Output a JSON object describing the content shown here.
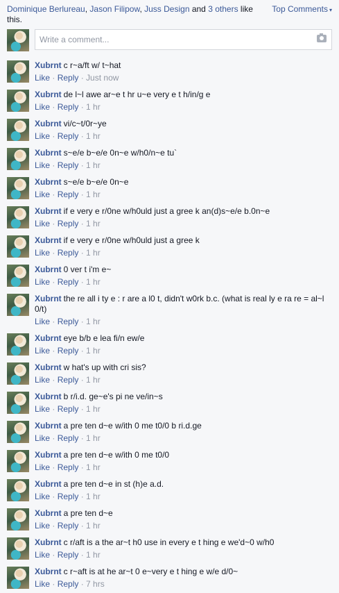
{
  "header": {
    "names_a": "Dominique Berlureau",
    "sep_a": ", ",
    "names_b": "Jason Filipow",
    "sep_b": ", ",
    "names_c": "Juss Design",
    "and": " and ",
    "others": "3 others",
    "like_this": " like this.",
    "sort_label": "Top Comments"
  },
  "composer": {
    "placeholder": "Write a comment..."
  },
  "labels": {
    "like": "Like",
    "reply": "Reply",
    "dot": " · "
  },
  "comments": [
    {
      "author": "Xubrnt",
      "text": "c r~a/ft w/ t~hat",
      "time": "Just now"
    },
    {
      "author": "Xubrnt",
      "text": "de l~l awe ar~e t hr u~e very e t h/in/g e",
      "time": "1 hr"
    },
    {
      "author": "Xubrnt",
      "text": "vi/c~t/0r~ye",
      "time": "1 hr"
    },
    {
      "author": "Xubrnt",
      "text": "s~e/e b~e/e 0n~e w/h0/n~e tu`",
      "time": "1 hr"
    },
    {
      "author": "Xubrnt",
      "text": "s~e/e b~e/e 0n~e",
      "time": "1 hr"
    },
    {
      "author": "Xubrnt",
      "text": "if e very e r/0ne w/h0uld just a gree k an(d)s~e/e b.0n~e",
      "time": "1 hr"
    },
    {
      "author": "Xubrnt",
      "text": "if e very e r/0ne w/h0uld just a gree k",
      "time": "1 hr"
    },
    {
      "author": "Xubrnt",
      "text": "0 ver t i'm e~",
      "time": "1 hr"
    },
    {
      "author": "Xubrnt",
      "text": "the re all i ty e : r are a l0 t, didn't w0rk b.c. (what is real ly e ra re = al~l 0/t)",
      "time": "1 hr"
    },
    {
      "author": "Xubrnt",
      "text": "eye b/b e lea fi/n ew/e",
      "time": "1 hr"
    },
    {
      "author": "Xubrnt",
      "text": "w hat's up with cri sis?",
      "time": "1 hr"
    },
    {
      "author": "Xubrnt",
      "text": "b r/i.d. ge~e's pi ne ve/in~s",
      "time": "1 hr"
    },
    {
      "author": "Xubrnt",
      "text": "a pre ten d~e w/ith 0 me t0/0 b ri.d.ge",
      "time": "1 hr"
    },
    {
      "author": "Xubrnt",
      "text": "a pre ten d~e w/ith 0 me t0/0",
      "time": "1 hr"
    },
    {
      "author": "Xubrnt",
      "text": "a pre ten d~e in st (h)e a.d.",
      "time": "1 hr"
    },
    {
      "author": "Xubrnt",
      "text": "a pre ten d~e",
      "time": "1 hr"
    },
    {
      "author": "Xubrnt",
      "text": "c r/aft is a the ar~t h0 use in every e t hing e we'd~0 w/h0",
      "time": "1 hr"
    },
    {
      "author": "Xubrnt",
      "text": "c r~aft is at he ar~t 0 e~very e t hing e w/e d/0~",
      "time": "7 hrs"
    }
  ]
}
